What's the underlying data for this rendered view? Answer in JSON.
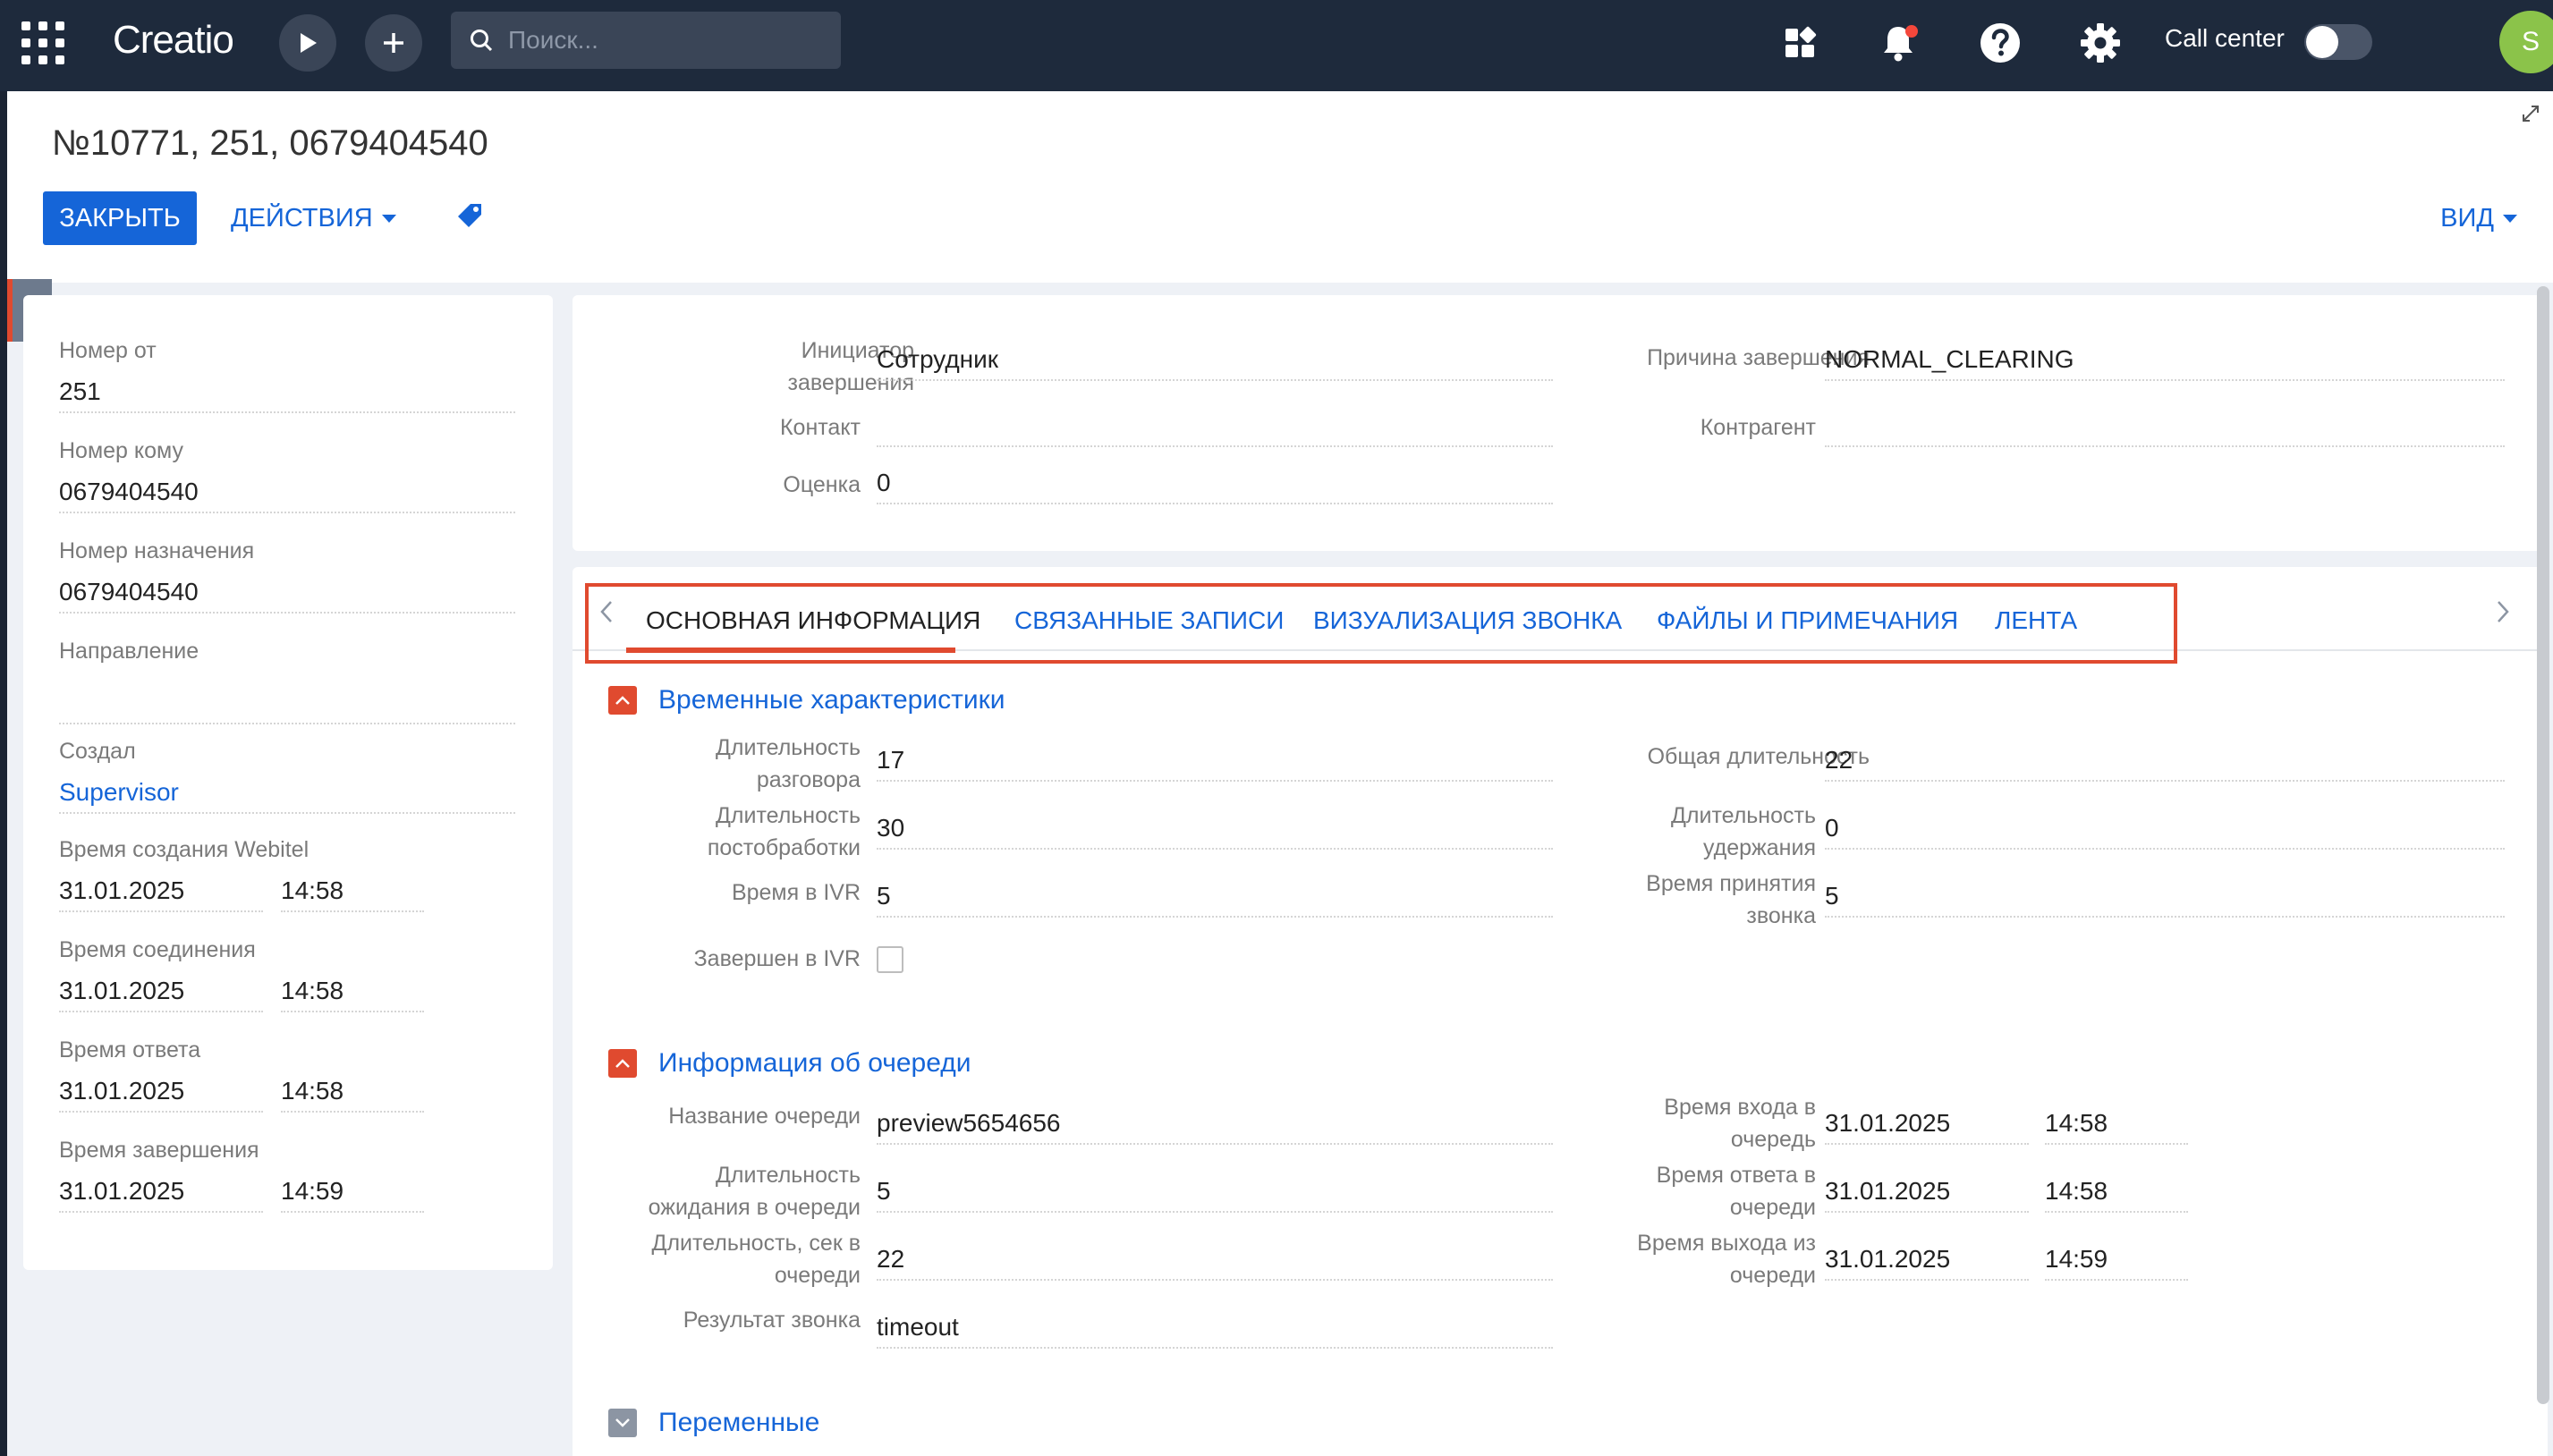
{
  "topbar": {
    "logo": "Creatio",
    "search_placeholder": "Поиск...",
    "call_center_label": "Call center",
    "avatar_initial": "S"
  },
  "header": {
    "title": "№10771, 251, 0679404540",
    "close_label": "ЗАКРЫТЬ",
    "actions_label": "ДЕЙСТВИЯ",
    "view_label": "ВИД"
  },
  "left": {
    "from_label": "Номер от",
    "from_value": "251",
    "to_label": "Номер кому",
    "to_value": "0679404540",
    "dest_label": "Номер назначения",
    "dest_value": "0679404540",
    "direction_label": "Направление",
    "direction_value": "",
    "created_by_label": "Создал",
    "created_by_value": "Supervisor",
    "webitel_created_label": "Время создания Webitel",
    "webitel_created_date": "31.01.2025",
    "webitel_created_time": "14:58",
    "connect_label": "Время соединения",
    "connect_date": "31.01.2025",
    "connect_time": "14:58",
    "answer_label": "Время ответа",
    "answer_date": "31.01.2025",
    "answer_time": "14:58",
    "end_label": "Время завершения",
    "end_date": "31.01.2025",
    "end_time": "14:59"
  },
  "top": {
    "initiator_label_1": "Инициатор",
    "initiator_label_2": "завершения",
    "initiator_value": "Сотрудник",
    "reason_label": "Причина завершения",
    "reason_value": "NORMAL_CLEARING",
    "contact_label": "Контакт",
    "contact_value": "",
    "account_label": "Контрагент",
    "account_value": "",
    "rating_label": "Оценка",
    "rating_value": "0"
  },
  "tabs": [
    "ОСНОВНАЯ ИНФОРМАЦИЯ",
    "СВЯЗАННЫЕ ЗАПИСИ",
    "ВИЗУАЛИЗАЦИЯ ЗВОНКА",
    "ФАЙЛЫ И ПРИМЕЧАНИЯ",
    "ЛЕНТА"
  ],
  "time_section": {
    "title": "Временные характеристики",
    "talk_label_1": "Длительность",
    "talk_label_2": "разговора",
    "talk_value": "17",
    "total_label": "Общая длительность",
    "total_value": "22",
    "post_label_1": "Длительность",
    "post_label_2": "постобработки",
    "post_value": "30",
    "hold_label_1": "Длительность",
    "hold_label_2": "удержания",
    "hold_value": "0",
    "ivr_label": "Время в IVR",
    "ivr_value": "5",
    "accept_label_1": "Время принятия",
    "accept_label_2": "звонка",
    "accept_value": "5",
    "ivr_done_label": "Завершен в IVR"
  },
  "queue_section": {
    "title": "Информация об очереди",
    "name_label": "Название очереди",
    "name_value": "preview5654656",
    "enter_label_1": "Время входа в",
    "enter_label_2": "очередь",
    "enter_date": "31.01.2025",
    "enter_time": "14:58",
    "wait_label_1": "Длительность",
    "wait_label_2": "ожидания в очереди",
    "wait_value": "5",
    "qanswer_label_1": "Время ответа в",
    "qanswer_label_2": "очереди",
    "qanswer_date": "31.01.2025",
    "qanswer_time": "14:58",
    "sec_label_1": "Длительность, сек в",
    "sec_label_2": "очереди",
    "sec_value": "22",
    "exit_label_1": "Время выхода из",
    "exit_label_2": "очереди",
    "exit_date": "31.01.2025",
    "exit_time": "14:59",
    "result_label": "Результат звонка",
    "result_value": "timeout"
  },
  "vars_section": {
    "title": "Переменные"
  }
}
